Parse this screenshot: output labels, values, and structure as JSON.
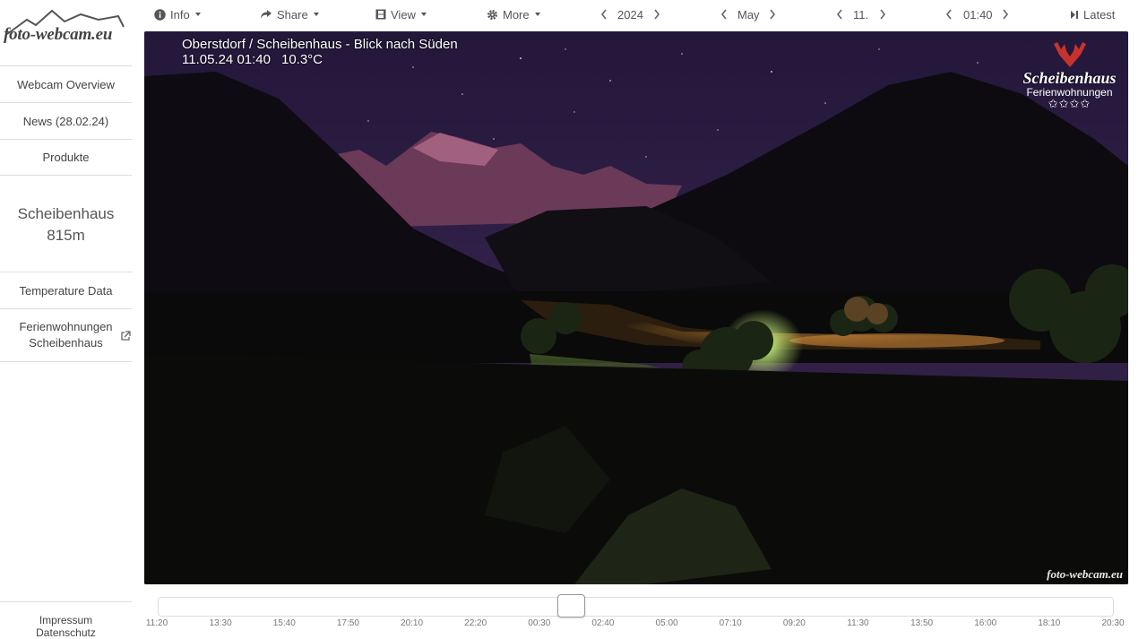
{
  "logo": {
    "text": "foto-webcam.eu"
  },
  "sidebar": {
    "items": [
      {
        "label": "Webcam Overview"
      },
      {
        "label": "News (28.02.24)"
      },
      {
        "label": "Produkte"
      }
    ],
    "cam_name": "Scheibenhaus",
    "cam_altitude": "815m",
    "items2": [
      {
        "label": "Temperature Data"
      },
      {
        "label": "Ferienwohnungen Scheibenhaus"
      }
    ],
    "footer": {
      "impressum": "Impressum",
      "datenschutz": "Datenschutz"
    }
  },
  "toolbar": {
    "info": "Info",
    "share": "Share",
    "view": "View",
    "more": "More",
    "year": "2024",
    "month": "May",
    "day": "11.",
    "time": "01:40",
    "latest": "Latest"
  },
  "image": {
    "title": "Oberstdorf / Scheibenhaus - Blick nach Süden",
    "datetime": "11.05.24 01:40",
    "temperature": "10.3°C",
    "brand_name": "Scheibenhaus",
    "brand_sub": "Ferienwohnungen",
    "brand_stars": "✩✩✩✩",
    "watermark": "foto-webcam.eu"
  },
  "timeline": {
    "current_fraction": 0.432,
    "ticks": [
      "11:20",
      "13:30",
      "15:40",
      "17:50",
      "20:10",
      "22:20",
      "00:30",
      "02:40",
      "05:00",
      "07:10",
      "09:20",
      "11:30",
      "13:50",
      "16:00",
      "18:10",
      "20:30"
    ]
  },
  "colors": {
    "accent": "#555555",
    "sky": "#2a1c3a",
    "field_glow": "#7fa34a",
    "orange_light": "#e08a2a"
  },
  "icons": [
    "info-icon",
    "share-icon",
    "film-icon",
    "gear-icon",
    "chevron-left-icon",
    "chevron-right-icon",
    "latest-icon",
    "external-link-icon",
    "mountain-logo-icon",
    "antlers-icon"
  ]
}
